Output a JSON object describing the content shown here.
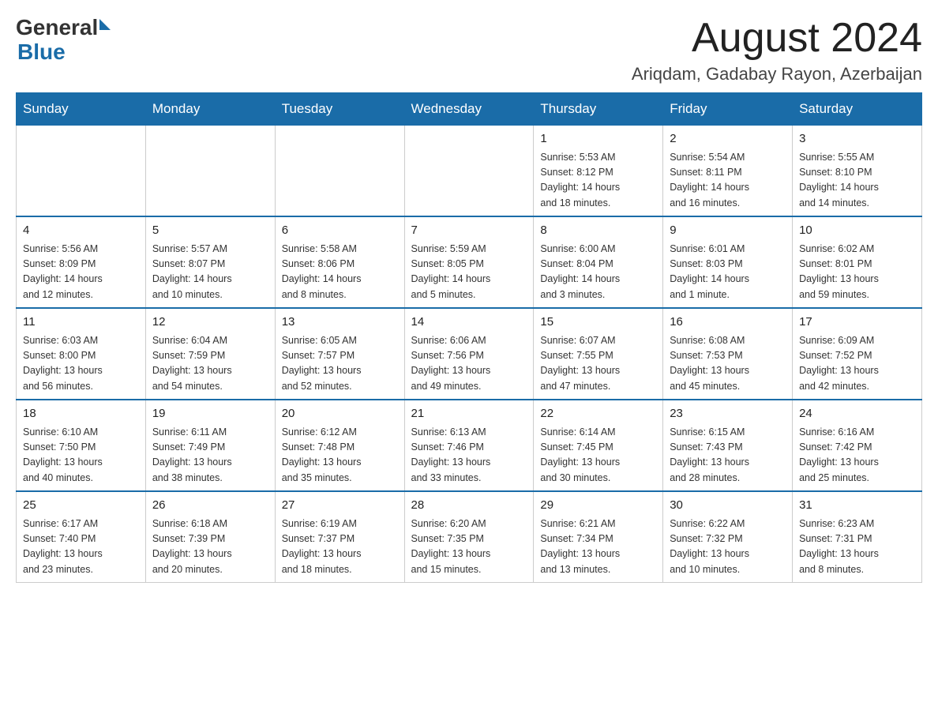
{
  "header": {
    "logo_general": "General",
    "logo_blue": "Blue",
    "month_year": "August 2024",
    "location": "Ariqdam, Gadabay Rayon, Azerbaijan"
  },
  "days_of_week": [
    "Sunday",
    "Monday",
    "Tuesday",
    "Wednesday",
    "Thursday",
    "Friday",
    "Saturday"
  ],
  "weeks": [
    {
      "days": [
        {
          "num": "",
          "info": ""
        },
        {
          "num": "",
          "info": ""
        },
        {
          "num": "",
          "info": ""
        },
        {
          "num": "",
          "info": ""
        },
        {
          "num": "1",
          "info": "Sunrise: 5:53 AM\nSunset: 8:12 PM\nDaylight: 14 hours\nand 18 minutes."
        },
        {
          "num": "2",
          "info": "Sunrise: 5:54 AM\nSunset: 8:11 PM\nDaylight: 14 hours\nand 16 minutes."
        },
        {
          "num": "3",
          "info": "Sunrise: 5:55 AM\nSunset: 8:10 PM\nDaylight: 14 hours\nand 14 minutes."
        }
      ]
    },
    {
      "days": [
        {
          "num": "4",
          "info": "Sunrise: 5:56 AM\nSunset: 8:09 PM\nDaylight: 14 hours\nand 12 minutes."
        },
        {
          "num": "5",
          "info": "Sunrise: 5:57 AM\nSunset: 8:07 PM\nDaylight: 14 hours\nand 10 minutes."
        },
        {
          "num": "6",
          "info": "Sunrise: 5:58 AM\nSunset: 8:06 PM\nDaylight: 14 hours\nand 8 minutes."
        },
        {
          "num": "7",
          "info": "Sunrise: 5:59 AM\nSunset: 8:05 PM\nDaylight: 14 hours\nand 5 minutes."
        },
        {
          "num": "8",
          "info": "Sunrise: 6:00 AM\nSunset: 8:04 PM\nDaylight: 14 hours\nand 3 minutes."
        },
        {
          "num": "9",
          "info": "Sunrise: 6:01 AM\nSunset: 8:03 PM\nDaylight: 14 hours\nand 1 minute."
        },
        {
          "num": "10",
          "info": "Sunrise: 6:02 AM\nSunset: 8:01 PM\nDaylight: 13 hours\nand 59 minutes."
        }
      ]
    },
    {
      "days": [
        {
          "num": "11",
          "info": "Sunrise: 6:03 AM\nSunset: 8:00 PM\nDaylight: 13 hours\nand 56 minutes."
        },
        {
          "num": "12",
          "info": "Sunrise: 6:04 AM\nSunset: 7:59 PM\nDaylight: 13 hours\nand 54 minutes."
        },
        {
          "num": "13",
          "info": "Sunrise: 6:05 AM\nSunset: 7:57 PM\nDaylight: 13 hours\nand 52 minutes."
        },
        {
          "num": "14",
          "info": "Sunrise: 6:06 AM\nSunset: 7:56 PM\nDaylight: 13 hours\nand 49 minutes."
        },
        {
          "num": "15",
          "info": "Sunrise: 6:07 AM\nSunset: 7:55 PM\nDaylight: 13 hours\nand 47 minutes."
        },
        {
          "num": "16",
          "info": "Sunrise: 6:08 AM\nSunset: 7:53 PM\nDaylight: 13 hours\nand 45 minutes."
        },
        {
          "num": "17",
          "info": "Sunrise: 6:09 AM\nSunset: 7:52 PM\nDaylight: 13 hours\nand 42 minutes."
        }
      ]
    },
    {
      "days": [
        {
          "num": "18",
          "info": "Sunrise: 6:10 AM\nSunset: 7:50 PM\nDaylight: 13 hours\nand 40 minutes."
        },
        {
          "num": "19",
          "info": "Sunrise: 6:11 AM\nSunset: 7:49 PM\nDaylight: 13 hours\nand 38 minutes."
        },
        {
          "num": "20",
          "info": "Sunrise: 6:12 AM\nSunset: 7:48 PM\nDaylight: 13 hours\nand 35 minutes."
        },
        {
          "num": "21",
          "info": "Sunrise: 6:13 AM\nSunset: 7:46 PM\nDaylight: 13 hours\nand 33 minutes."
        },
        {
          "num": "22",
          "info": "Sunrise: 6:14 AM\nSunset: 7:45 PM\nDaylight: 13 hours\nand 30 minutes."
        },
        {
          "num": "23",
          "info": "Sunrise: 6:15 AM\nSunset: 7:43 PM\nDaylight: 13 hours\nand 28 minutes."
        },
        {
          "num": "24",
          "info": "Sunrise: 6:16 AM\nSunset: 7:42 PM\nDaylight: 13 hours\nand 25 minutes."
        }
      ]
    },
    {
      "days": [
        {
          "num": "25",
          "info": "Sunrise: 6:17 AM\nSunset: 7:40 PM\nDaylight: 13 hours\nand 23 minutes."
        },
        {
          "num": "26",
          "info": "Sunrise: 6:18 AM\nSunset: 7:39 PM\nDaylight: 13 hours\nand 20 minutes."
        },
        {
          "num": "27",
          "info": "Sunrise: 6:19 AM\nSunset: 7:37 PM\nDaylight: 13 hours\nand 18 minutes."
        },
        {
          "num": "28",
          "info": "Sunrise: 6:20 AM\nSunset: 7:35 PM\nDaylight: 13 hours\nand 15 minutes."
        },
        {
          "num": "29",
          "info": "Sunrise: 6:21 AM\nSunset: 7:34 PM\nDaylight: 13 hours\nand 13 minutes."
        },
        {
          "num": "30",
          "info": "Sunrise: 6:22 AM\nSunset: 7:32 PM\nDaylight: 13 hours\nand 10 minutes."
        },
        {
          "num": "31",
          "info": "Sunrise: 6:23 AM\nSunset: 7:31 PM\nDaylight: 13 hours\nand 8 minutes."
        }
      ]
    }
  ]
}
